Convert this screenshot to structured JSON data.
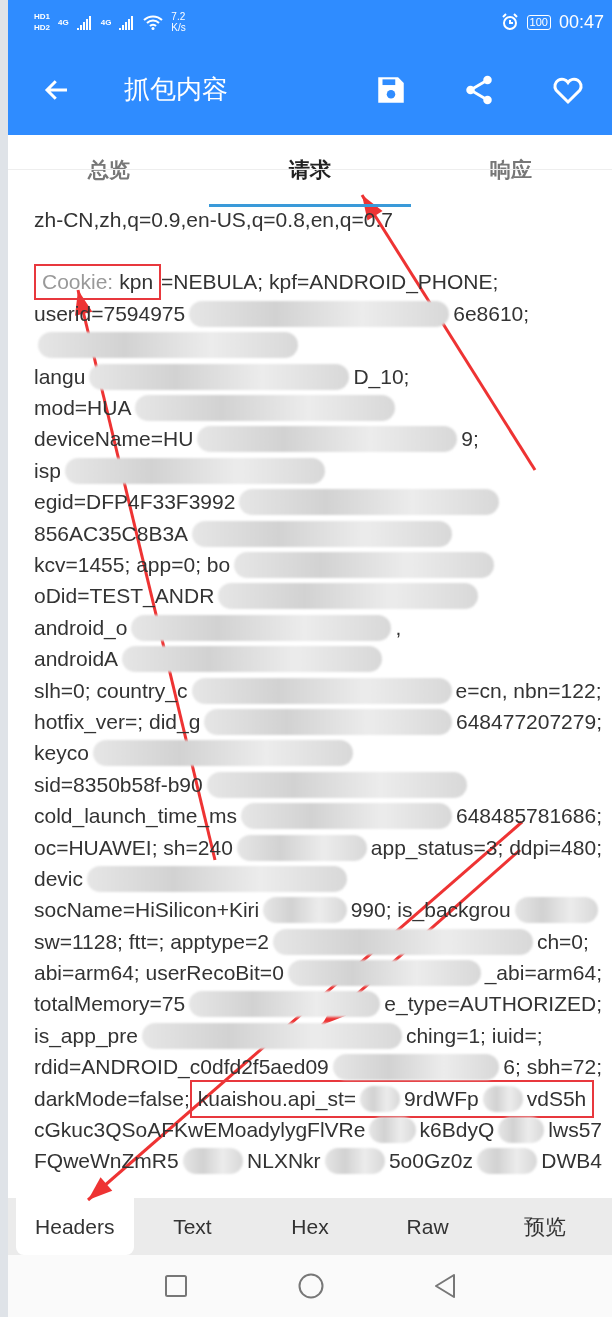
{
  "status_bar": {
    "sims": [
      {
        "badge": "HD",
        "slot": "1"
      },
      {
        "badge": "HD",
        "slot": "2"
      }
    ],
    "networks": [
      "4G",
      "4G"
    ],
    "speed": "7.2",
    "speed_unit": "K/s",
    "battery": "100",
    "time": "00:47"
  },
  "app_bar": {
    "title": "抓包内容"
  },
  "tabs": [
    {
      "label": "总览",
      "selected": false
    },
    {
      "label": "请求",
      "selected": true
    },
    {
      "label": "响应",
      "selected": false
    }
  ],
  "lines": [
    {
      "segments": [
        {
          "kind": "value",
          "text": "zh-CN,zh,q=0.9,en-US,q=0.8,en,q=0.7"
        }
      ]
    },
    {
      "kind": "blank"
    },
    {
      "segments": [
        {
          "kind": "label",
          "text": "Cookie:",
          "boxed": true
        },
        {
          "kind": "value",
          "text": "kpn",
          "boxed": true
        },
        {
          "kind": "value",
          "text": "=NEBULA; kpf=ANDROID_PHONE;"
        }
      ]
    },
    {
      "segments": [
        {
          "kind": "value",
          "text": "userid=7594975"
        },
        {
          "kind": "blur"
        },
        {
          "kind": "value",
          "text": "6e8610;"
        }
      ]
    },
    {
      "segments": [
        {
          "kind": "blur"
        }
      ]
    },
    {
      "segments": [
        {
          "kind": "value",
          "text": "langu"
        },
        {
          "kind": "blur"
        },
        {
          "kind": "value",
          "text": "D_10;"
        }
      ]
    },
    {
      "segments": [
        {
          "kind": "value",
          "text": "mod=HUA"
        },
        {
          "kind": "blur"
        }
      ]
    },
    {
      "segments": [
        {
          "kind": "value",
          "text": "deviceName=HU"
        },
        {
          "kind": "blur"
        },
        {
          "kind": "value",
          "text": "9;"
        }
      ]
    },
    {
      "segments": [
        {
          "kind": "value",
          "text": "isp"
        },
        {
          "kind": "blur"
        }
      ]
    },
    {
      "segments": [
        {
          "kind": "value",
          "text": "egid=DFP4F33F3992"
        },
        {
          "kind": "blur"
        }
      ]
    },
    {
      "segments": [
        {
          "kind": "value",
          "text": "856AC35C8B3A"
        },
        {
          "kind": "blur"
        }
      ]
    },
    {
      "segments": [
        {
          "kind": "value",
          "text": "kcv=1455; app=0; bo"
        },
        {
          "kind": "blur"
        }
      ]
    },
    {
      "segments": [
        {
          "kind": "value",
          "text": "oDid=TEST_ANDR"
        },
        {
          "kind": "blur"
        }
      ]
    },
    {
      "segments": [
        {
          "kind": "value",
          "text": "android_o"
        },
        {
          "kind": "blur"
        },
        {
          "kind": "value",
          "text": ","
        }
      ]
    },
    {
      "segments": [
        {
          "kind": "value",
          "text": "androidA"
        },
        {
          "kind": "blur"
        }
      ]
    },
    {
      "segments": [
        {
          "kind": "value",
          "text": "slh=0; country_c"
        },
        {
          "kind": "blur"
        },
        {
          "kind": "value",
          "text": "e=cn, nbn=122;"
        }
      ]
    },
    {
      "segments": [
        {
          "kind": "value",
          "text": "hotfix_ver=; did_g"
        },
        {
          "kind": "blur"
        },
        {
          "kind": "value",
          "text": "648477207279;"
        }
      ]
    },
    {
      "segments": [
        {
          "kind": "value",
          "text": "keyco"
        },
        {
          "kind": "blur"
        }
      ]
    },
    {
      "segments": [
        {
          "kind": "value",
          "text": "sid=8350b58f-b90"
        },
        {
          "kind": "blur"
        }
      ]
    },
    {
      "segments": [
        {
          "kind": "value",
          "text": "cold_launch_time_ms"
        },
        {
          "kind": "blur"
        },
        {
          "kind": "value",
          "text": "648485781686;"
        }
      ]
    },
    {
      "segments": [
        {
          "kind": "value",
          "text": "oc=HUAWEI; sh=240"
        },
        {
          "kind": "blur"
        },
        {
          "kind": "value",
          "text": "app_status=3; ddpi=480;"
        }
      ]
    },
    {
      "segments": [
        {
          "kind": "value",
          "text": "devic"
        },
        {
          "kind": "blur"
        }
      ]
    },
    {
      "segments": [
        {
          "kind": "value",
          "text": "socName=HiSilicon+Kiri"
        },
        {
          "kind": "blur"
        },
        {
          "kind": "value",
          "text": "990; is_backgrou"
        },
        {
          "kind": "blur"
        }
      ]
    },
    {
      "segments": [
        {
          "kind": "value",
          "text": "sw=1128; ftt=; apptype=2"
        },
        {
          "kind": "blur"
        },
        {
          "kind": "value",
          "text": "ch=0;"
        }
      ]
    },
    {
      "segments": [
        {
          "kind": "value",
          "text": "abi=arm64; userRecoBit=0"
        },
        {
          "kind": "blur"
        },
        {
          "kind": "value",
          "text": "_abi=arm64;"
        }
      ]
    },
    {
      "segments": [
        {
          "kind": "value",
          "text": "totalMemory=75"
        },
        {
          "kind": "blur"
        },
        {
          "kind": "value",
          "text": "e_type=AUTHORIZED;"
        }
      ]
    },
    {
      "segments": [
        {
          "kind": "value",
          "text": "is_app_pre"
        },
        {
          "kind": "blur"
        },
        {
          "kind": "value",
          "text": "ching=1; iuid=;"
        }
      ]
    },
    {
      "segments": [
        {
          "kind": "value",
          "text": "rdid=ANDROID_c0dfd2f5aed09"
        },
        {
          "kind": "blur"
        },
        {
          "kind": "value",
          "text": "6; sbh=72;"
        }
      ]
    },
    {
      "segments": [
        {
          "kind": "value",
          "text": "darkMode=false;"
        },
        {
          "kind": "value",
          "text": "kuaishou.api_st=",
          "boxed": true
        },
        {
          "kind": "blur",
          "boxed": true
        },
        {
          "kind": "value",
          "text": "9rdWFp",
          "boxed": true
        },
        {
          "kind": "blur",
          "boxed": true
        },
        {
          "kind": "value",
          "text": "vdS5h",
          "boxed": true
        }
      ]
    },
    {
      "segments": [
        {
          "kind": "value",
          "text": "cGkuc3QSoAFKwEMoadylygFlVRe"
        },
        {
          "kind": "blur"
        },
        {
          "kind": "value",
          "text": "k6BdyQ"
        },
        {
          "kind": "blur"
        },
        {
          "kind": "value",
          "text": "lws57"
        }
      ]
    },
    {
      "segments": [
        {
          "kind": "value",
          "text": "FQweWnZmR5"
        },
        {
          "kind": "blur"
        },
        {
          "kind": "value",
          "text": "NLXNkr"
        },
        {
          "kind": "blur"
        },
        {
          "kind": "value",
          "text": "5o0Gz0z"
        },
        {
          "kind": "blur"
        },
        {
          "kind": "value",
          "text": "DWB4"
        }
      ]
    }
  ],
  "view_tabs": [
    {
      "label": "Headers",
      "selected": true
    },
    {
      "label": "Text",
      "selected": false
    },
    {
      "label": "Hex",
      "selected": false
    },
    {
      "label": "Raw",
      "selected": false
    },
    {
      "label": "预览",
      "selected": false
    }
  ]
}
